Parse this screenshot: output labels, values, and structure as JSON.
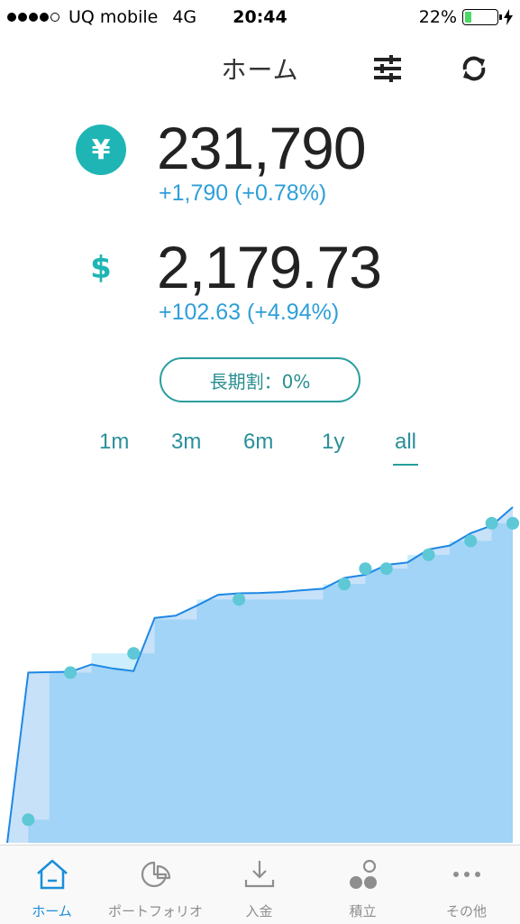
{
  "status_bar": {
    "carrier": "UQ mobile",
    "network": "4G",
    "time": "20:44",
    "battery_percent": "22%",
    "battery_level": 0.22,
    "signal_bars": 4
  },
  "header": {
    "title": "ホーム",
    "settings_icon": "sliders-icon",
    "refresh_icon": "refresh-icon"
  },
  "balances": {
    "jpy": {
      "icon": "¥",
      "amount": "231,790",
      "change": "+1,790 (+0.78%)"
    },
    "usd": {
      "icon": "$",
      "amount": "2,179.73",
      "change": "+102.63 (+4.94%)"
    }
  },
  "discount_button": "長期割：0%",
  "ranges": [
    "1m",
    "3m",
    "6m",
    "1y",
    "all"
  ],
  "active_range": "all",
  "colors": {
    "accent": "#1fb5b5",
    "change": "#2e9fd9",
    "chart_fill": "#cdeefc",
    "chart_line": "#1e88e5",
    "chart_marker": "#5ec8d6"
  },
  "chart_data": {
    "type": "area",
    "title": "",
    "xlabel": "",
    "ylabel": "",
    "note": "No axes printed; values in USD estimated relative to final value 2,179.73.",
    "invested": [
      0,
      150,
      1105,
      1105,
      1230,
      1230,
      1230,
      1450,
      1450,
      1580,
      1580,
      1580,
      1580,
      1580,
      1580,
      1680,
      1680,
      1780,
      1780,
      1870,
      1870,
      1960,
      1960,
      2075,
      2075
    ],
    "value": [
      0,
      1105,
      1108,
      1110,
      1158,
      1132,
      1115,
      1460,
      1475,
      1540,
      1610,
      1620,
      1622,
      1628,
      1640,
      1650,
      1720,
      1740,
      1805,
      1820,
      1905,
      1930,
      2010,
      2060,
      2179.73
    ],
    "markers": [
      1,
      3,
      6,
      11,
      16,
      17,
      18,
      20,
      22,
      23,
      24
    ]
  },
  "tabbar": {
    "tabs": [
      {
        "label": "ホーム",
        "icon": "home-icon"
      },
      {
        "label": "ポートフォリオ",
        "icon": "pie-chart-icon"
      },
      {
        "label": "入金",
        "icon": "download-icon"
      },
      {
        "label": "積立",
        "icon": "accumulate-icon"
      },
      {
        "label": "その他",
        "icon": "more-icon"
      }
    ],
    "active": "ホーム"
  }
}
